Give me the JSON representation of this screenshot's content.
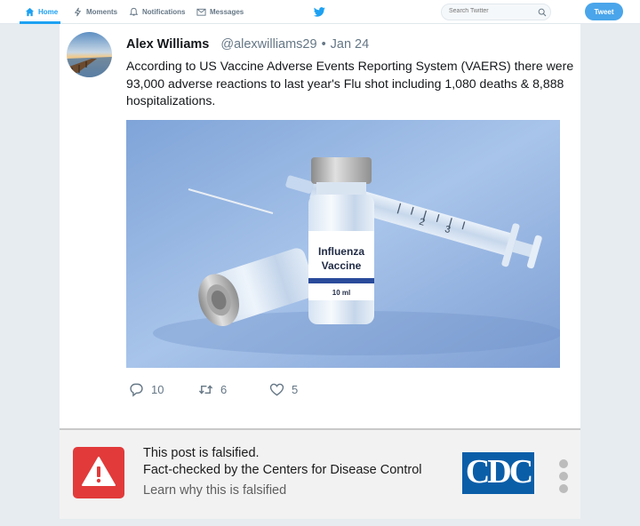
{
  "nav": {
    "home": "Home",
    "moments": "Moments",
    "notifications": "Notifications",
    "messages": "Messages",
    "search_placeholder": "Search Twitter",
    "tweet_button": "Tweet",
    "accent_color": "#1da1f2"
  },
  "tweet": {
    "author_name": "Alex Williams",
    "author_handle": "@alexwilliams29",
    "date": "Jan 24",
    "text": "According to US Vaccine Adverse Events Reporting System (VAERS) there were 93,000 adverse reactions to last year's Flu shot including 1,080 deaths & 8,888 hospitalizations.",
    "media": {
      "label_line1": "Influenza",
      "label_line2": "Vaccine",
      "label_volume": "10 ml"
    },
    "replies": "10",
    "retweets": "6",
    "likes": "5"
  },
  "factcheck": {
    "title": "This post is falsified.",
    "subtitle": "Fact-checked by the Centers for Disease Control",
    "link": "Learn why this is falsified",
    "logo_text": "CDC",
    "warning_color": "#e23a3a"
  }
}
